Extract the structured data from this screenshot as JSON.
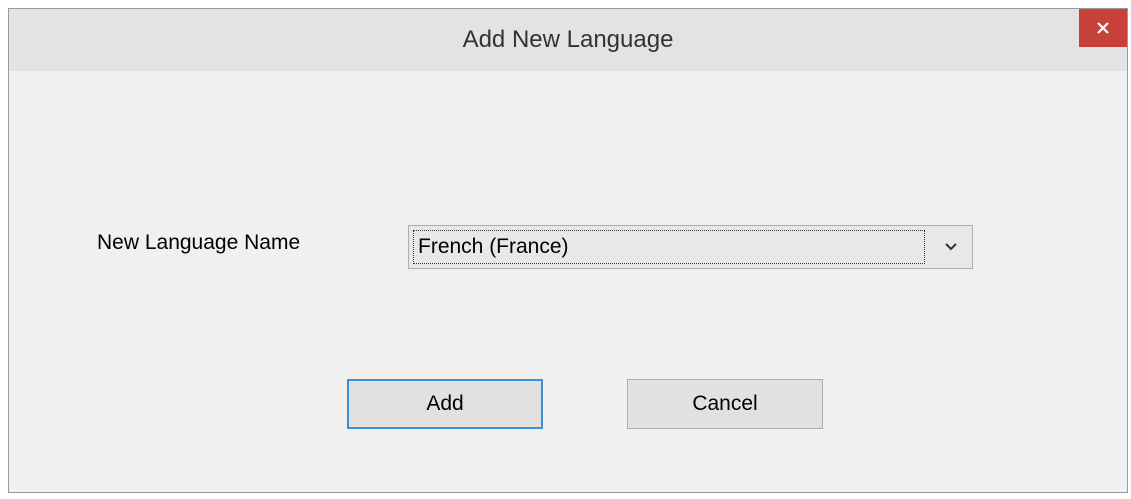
{
  "dialog": {
    "title": "Add New Language",
    "close_icon": "close-icon",
    "close_icon_color": "#ffffff",
    "close_button_color": "#c7403a"
  },
  "form": {
    "language_label": "New Language Name",
    "language_select": {
      "selected": "French (France)",
      "arrow_icon": "chevron-down-icon"
    }
  },
  "buttons": {
    "add_label": "Add",
    "cancel_label": "Cancel"
  },
  "colors": {
    "focus_border": "#3c8fdb"
  }
}
